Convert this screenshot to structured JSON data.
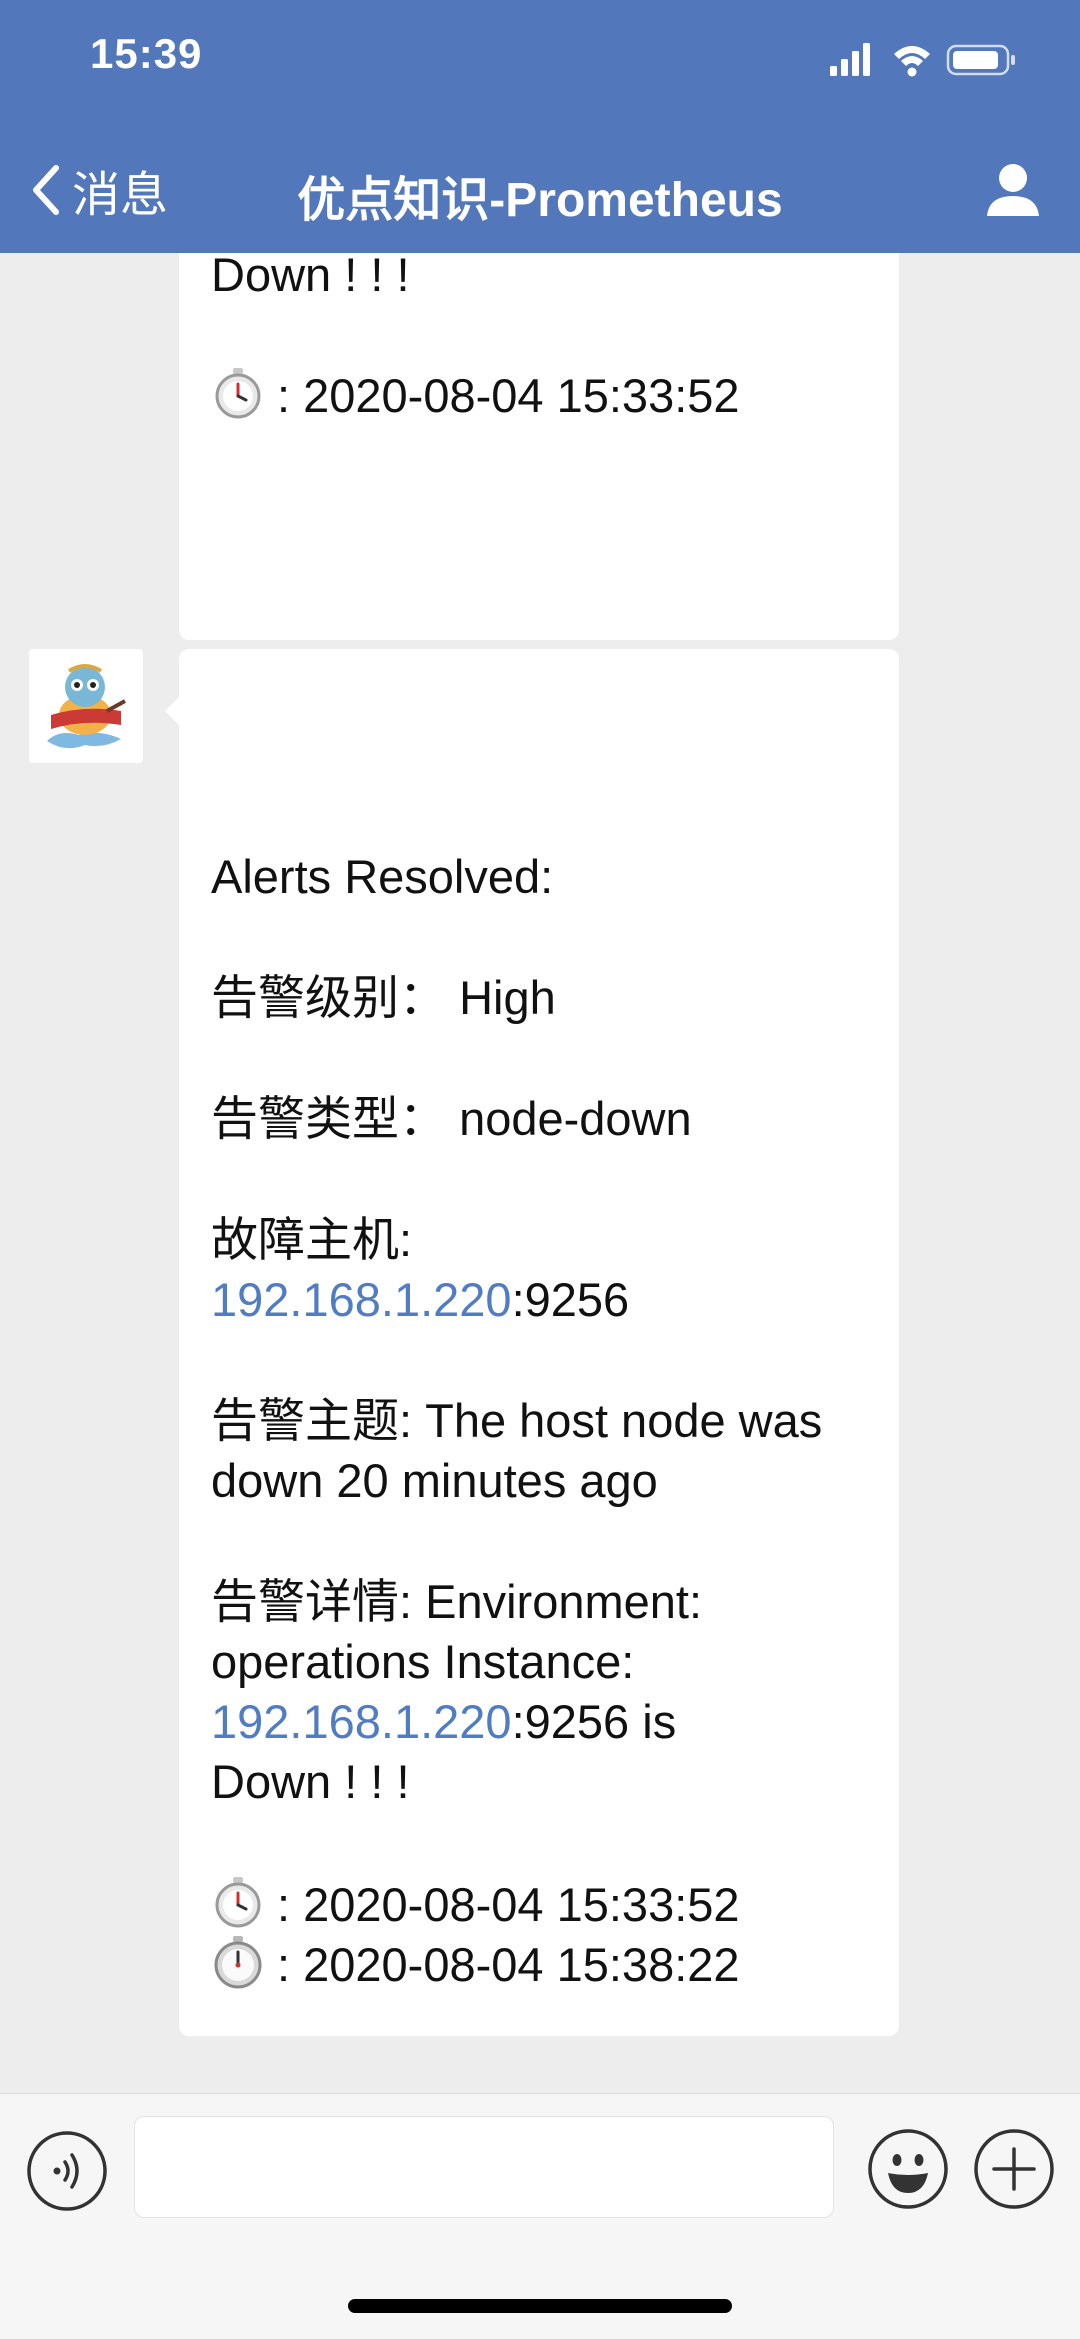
{
  "status_bar": {
    "time": "15:39"
  },
  "nav": {
    "back_label": "消息",
    "title": "优点知识-Prometheus"
  },
  "messages": [
    {
      "lines": [
        "Down ! ! !",
        "",
        ": 2020-08-04 15:33:52"
      ]
    },
    {
      "heading": "Alerts Resolved:",
      "level_label": "告警级别：",
      "level_value": "High",
      "type_label": "告警类型：",
      "type_value": "node-down",
      "host_label": "故障主机:",
      "host_ip": "192.168.1.220",
      "host_port": ":9256",
      "subject_line1": "告警主题: The host node was",
      "subject_line2": "down 20 minutes ago",
      "detail_line1": "告警详情: Environment:",
      "detail_line2": "operations Instance:",
      "detail_ip": "192.168.1.220",
      "detail_ip_rest": ":9256 is",
      "detail_line4": "Down ! ! !",
      "start_time": ": 2020-08-04 15:33:52",
      "end_time": ": 2020-08-04 15:38:22"
    }
  ],
  "input": {
    "placeholder": ""
  },
  "colors": {
    "nav_bg": "#5277ba",
    "link": "#4f7cc2",
    "chat_bg": "#ededed"
  }
}
